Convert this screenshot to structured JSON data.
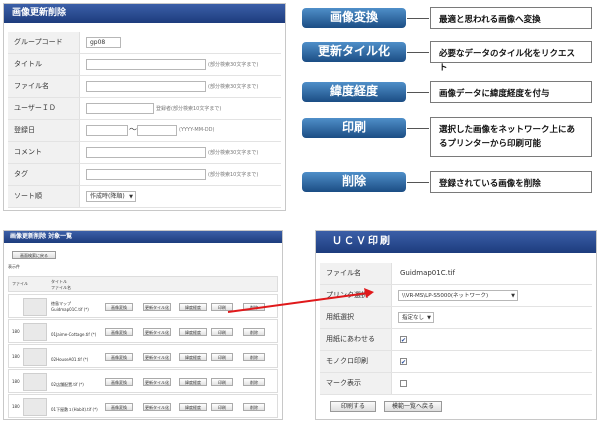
{
  "delete_panel": {
    "title": "画像更新削除",
    "fields": [
      {
        "label": "グループコード",
        "value": "gp08",
        "hint": ""
      },
      {
        "label": "タイトル",
        "value": "",
        "hint": "(部分検索30文字まで)"
      },
      {
        "label": "ファイル名",
        "value": "",
        "hint": "(部分検索30文字まで)"
      },
      {
        "label": "ユーザーＩＤ",
        "value": "",
        "hint": "登録者(部分検索10文字まで)"
      },
      {
        "label": "登録日",
        "value": "",
        "hint": "(YYYY-MM-DD)",
        "separator": "〜"
      },
      {
        "label": "コメント",
        "value": "",
        "hint": "(部分検索30文字まで)"
      },
      {
        "label": "タグ",
        "value": "",
        "hint": "(部分検索10文字まで)"
      },
      {
        "label": "ソート順",
        "value": "作成時(降順)",
        "hint": ""
      }
    ]
  },
  "features": [
    {
      "name": "画像変換",
      "desc": "最適と思われる画像へ変換"
    },
    {
      "name": "更新タイル化",
      "desc": "必要なデータのタイル化をリクエスト"
    },
    {
      "name": "緯度経度",
      "desc": "画像データに緯度経度を付与"
    },
    {
      "name": "印刷",
      "desc": "選択した画像をネットワーク上にあるプリンターから印刷可能"
    },
    {
      "name": "削除",
      "desc": "登録されている画像を削除"
    }
  ],
  "list_panel": {
    "title": "画像更新削除 対象一覧",
    "back_button": "画面検索に戻る",
    "count": "表示件",
    "col_headers": [
      "ファイル",
      "タイトル",
      "ファイル名"
    ],
    "rows": [
      {
        "id": "",
        "title": "徳島マップ",
        "file": "Guidmap01C.tif (*)"
      },
      {
        "id": "180",
        "title": "",
        "file": "01Jaime-Cottage.tif (*)"
      },
      {
        "id": "180",
        "title": "",
        "file": "02HouseA01.tif (*)"
      },
      {
        "id": "180",
        "title": "",
        "file": "02店舗配置.tif (*)"
      },
      {
        "id": "180",
        "title": "",
        "file": "01下屋敷１(Habit).tif (*)"
      }
    ],
    "row_buttons": [
      "画像変換",
      "更新タイル化",
      "緯度経度",
      "印刷",
      "削除"
    ]
  },
  "print_panel": {
    "title": "ＵＣＶ印刷",
    "fields": [
      {
        "label": "ファイル名",
        "value": "Guidmap01C.tif"
      },
      {
        "label": "プリンタ選択",
        "value": "\\\\VR-MS\\LP-S5000(ネットワーク)"
      },
      {
        "label": "用紙選択",
        "value": "指定なし"
      },
      {
        "label": "用紙にあわせる",
        "value": "✔"
      },
      {
        "label": "モノクロ印刷",
        "value": "✔"
      },
      {
        "label": "マーク表示",
        "value": ""
      }
    ],
    "print_button": "印刷する",
    "back_button": "模範一覧へ戻る"
  },
  "colors": {
    "accent": "#1d3c7d",
    "pill": "#2b66a8",
    "arrow": "#e0191b"
  }
}
